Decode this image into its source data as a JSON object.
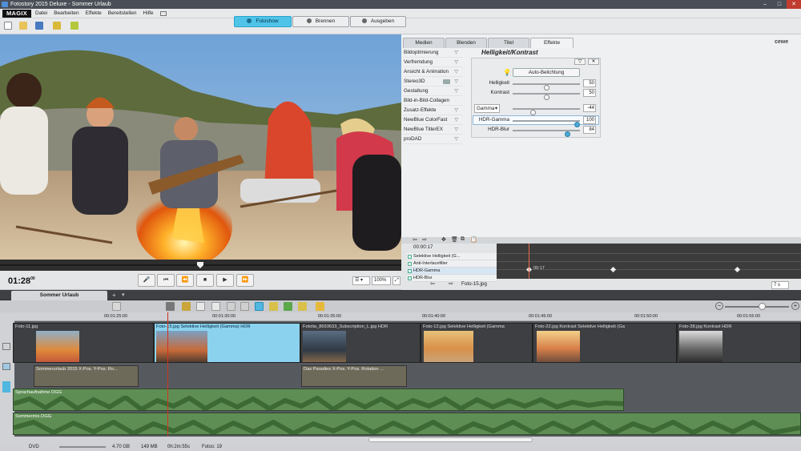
{
  "window": {
    "title": "Fotostory 2015 Deluxe - Sommer Urlaub",
    "minimize": "–",
    "maximize": "□",
    "close": "✕"
  },
  "brand": {
    "logo": "MAGIX",
    "partner_logo": "cewe"
  },
  "menu": [
    "Datei",
    "Bearbeiten",
    "Effekte",
    "Bereitstellen",
    "Hilfe"
  ],
  "modes": [
    {
      "label": "Fotoshow",
      "active": true
    },
    {
      "label": "Brennen",
      "active": false
    },
    {
      "label": "Ausgeben",
      "active": false
    }
  ],
  "tabs": [
    {
      "label": "Medien",
      "active": false
    },
    {
      "label": "Blenden",
      "active": false
    },
    {
      "label": "Titel",
      "active": false
    },
    {
      "label": "Effekte",
      "active": true
    }
  ],
  "effect_categories": [
    "Bildoptimierung",
    "Verfremdung",
    "Ansicht & Animation",
    "Stereo3D",
    "Gestaltung",
    "Bild-in-Bild-Collagen",
    "Zusatz-Effekte",
    "NewBlue ColorFast",
    "NewBlue TitlerEX",
    "proDAD"
  ],
  "effect_panel": {
    "title": "Helligkeit/Kontrast",
    "auto_button": "Auto-Belichtung",
    "params": [
      {
        "label": "Helligkeit",
        "value": "50",
        "level": 0.5
      },
      {
        "label": "Kontrast",
        "value": "50",
        "level": 0.5
      },
      {
        "label": "Gamma",
        "value": "-44",
        "level": 0.28
      },
      {
        "label": "HDR-Gamma",
        "value": "100",
        "level": 1.0
      },
      {
        "label": "HDR-Blur",
        "value": "84",
        "level": 0.84
      }
    ]
  },
  "keyframes": {
    "time": "00:00:17",
    "rows": [
      "Selektive Helligkeit (G...",
      "Anti-Interlacefilter",
      "HDR-Gamma",
      "HDR-Blur"
    ],
    "marker_label": "00:17",
    "file": "Foto-15.jpg",
    "duration": "7 s"
  },
  "transport": {
    "timecode": "01:28",
    "frames": "00",
    "zoom": "100%"
  },
  "timeline": {
    "project_tab": "Sommer Urlaub",
    "ruler": [
      "00:01:25:00",
      "00:01:30:00",
      "00:01:35:00",
      "00:01:40:00",
      "00:01:45:00",
      "00:01:50:00",
      "00:01:55:00"
    ],
    "clips": [
      "Foto-11.jpg",
      "Foto-15.jpg  Selektive Helligkeit (Gamma)  HDR",
      "Fotolia_8693633_Subscription_L.jpg  HDR",
      "Foto-12.jpg  Selektive Helligkeit (Gamma",
      "Foto-22.jpg  Kontrast  Selektive Helligkeit (Ga",
      "Foto-38.jpg  Kontrast  HDR"
    ],
    "title_clips": [
      "Sommerurlaub 2015  X-Pos.  Y-Pos.  Ro...",
      "Das Paradies  X-Pos.  Y-Pos.  Rotation ..."
    ],
    "audio": [
      "Sprachaufnahme.OGG",
      "Sommermix.OGG"
    ]
  },
  "status": {
    "disc": "DVD",
    "size": "4.70 GB",
    "used": "149 MB",
    "duration": "0h:2m:55s",
    "photos": "Fotos: 19"
  }
}
